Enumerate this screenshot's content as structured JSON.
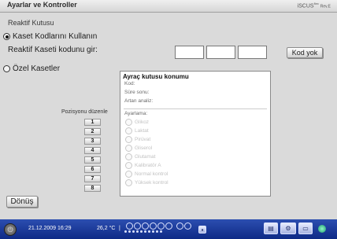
{
  "header": {
    "title": "Ayarlar ve Kontroller",
    "brand": "iSCUS",
    "brand_sup": "flex",
    "rev": "Rev.E"
  },
  "reagent": {
    "section_label": "Reaktif Kutusu",
    "use_codes_label": "Kaset Kodlarını Kullanın",
    "use_codes_checked": true,
    "enter_code_label": "Reaktif Kaseti kodunu gir:",
    "no_code_button": "Kod yok",
    "custom_label": "Özel Kasetler",
    "custom_checked": false
  },
  "panel": {
    "title": "Ayraç kutusu konumu",
    "lines": [
      "Kod:",
      "Süre sonu:",
      "Artan analiz:"
    ],
    "list_label": "Ayarlama:",
    "options": [
      "Glikoz",
      "Laktat",
      "Pirüvat",
      "Gliserol",
      "Glutamat",
      "Kalibratör A",
      "Normal kontrol",
      "Yüksek kontrol"
    ]
  },
  "positions": {
    "label": "Pozisyonu düzenle",
    "buttons": [
      "1",
      "2",
      "3",
      "4",
      "5",
      "6",
      "7",
      "8"
    ]
  },
  "footer": {
    "back_button": "Dönüş"
  },
  "statusbar": {
    "datetime": "21.12.2009 16:29",
    "temperature": "26,2 °C",
    "separator": "|"
  },
  "icons": {
    "power": "power-icon",
    "printer": "printer-icon",
    "settings": "gear-icon",
    "display": "monitor-icon",
    "small_box": "sample-icon"
  },
  "colors": {
    "statusbar": "#1a3a9a",
    "background": "#d9d9d9",
    "disabled_text": "#c2c2c2"
  }
}
